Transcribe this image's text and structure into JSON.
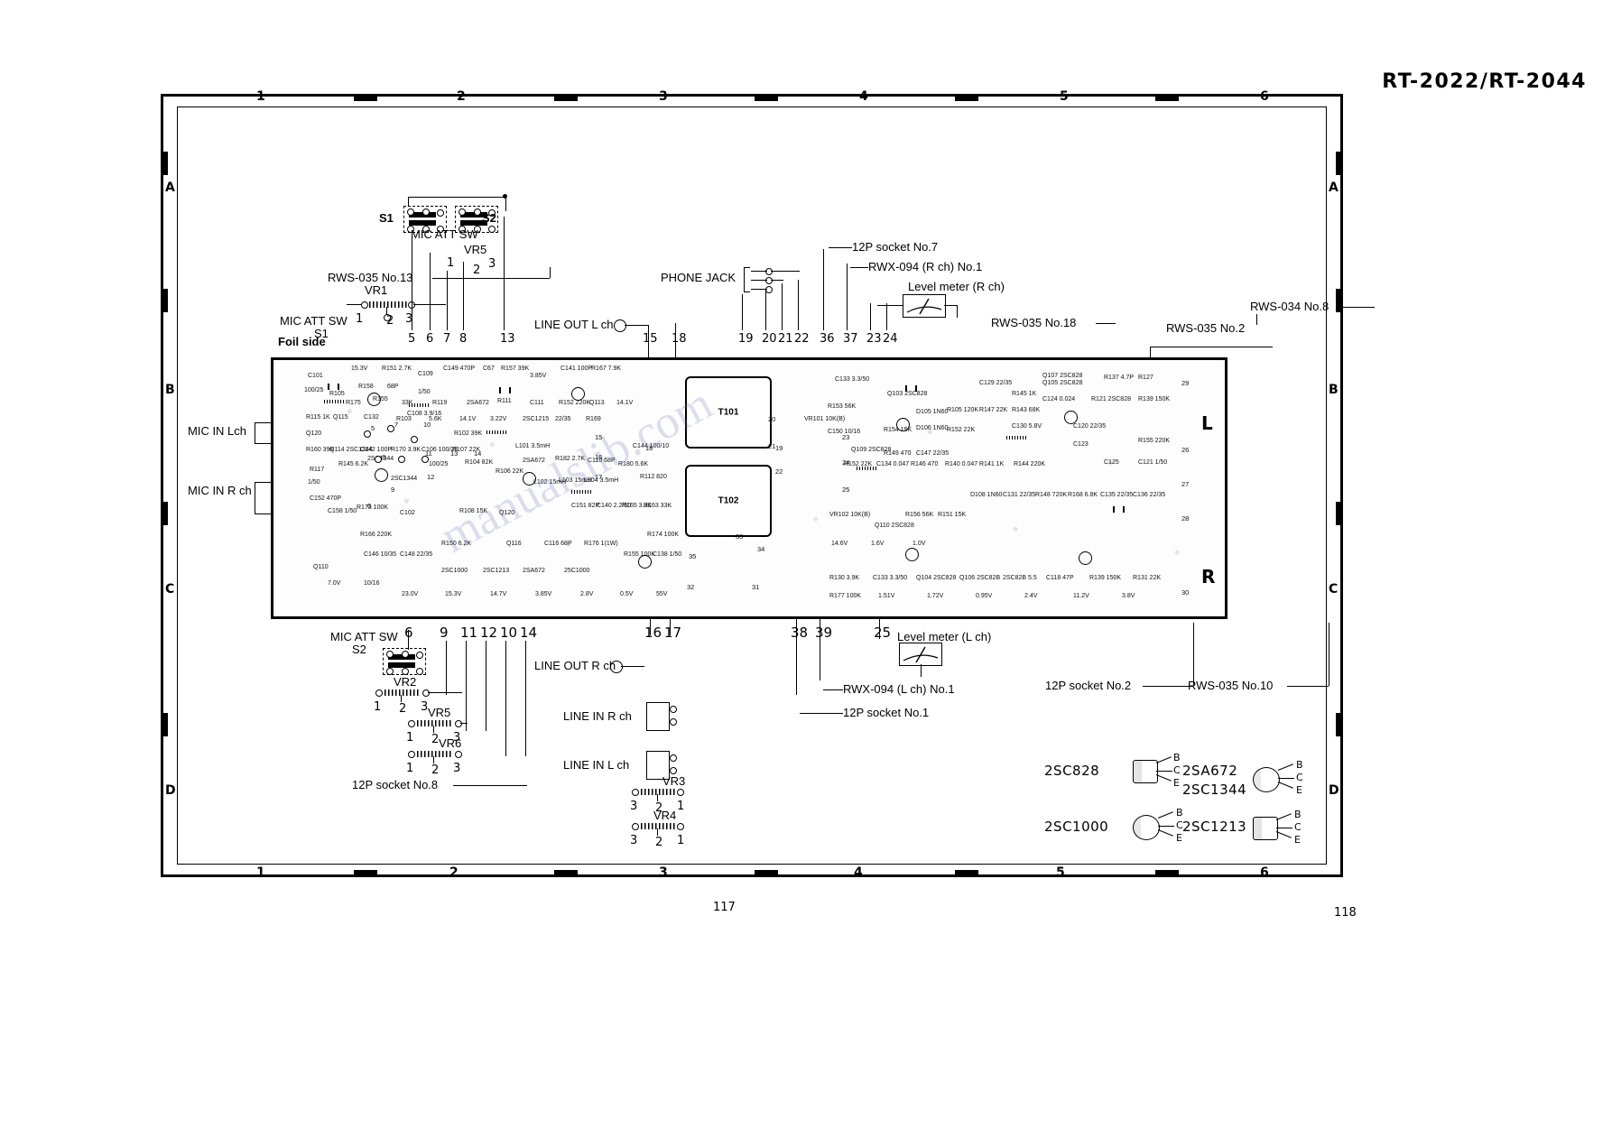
{
  "document": {
    "title": "RT-2022/RT-2044",
    "page_left": "117",
    "page_right": "118",
    "watermark": "manualslib.com"
  },
  "frame": {
    "columns": [
      "1",
      "2",
      "3",
      "4",
      "5",
      "6"
    ],
    "rows": [
      "A",
      "B",
      "C",
      "D"
    ]
  },
  "board": {
    "channel_upper": "L",
    "channel_lower": "R",
    "transformers": [
      {
        "label": "T101"
      },
      {
        "label": "T102"
      }
    ]
  },
  "annotations": {
    "foil_side": "Foil side",
    "mic_att_sw_top": "MIC ATT SW",
    "mic_att_sw_s1": "MIC ATT SW",
    "mic_att_sw_s1_ref": "S1",
    "mic_att_sw_s2": "MIC ATT SW",
    "mic_att_sw_s2_ref": "S2",
    "s1": "S1",
    "s2": "S2",
    "vr1": "VR1",
    "vr2": "VR2",
    "vr3": "VR3",
    "vr4": "VR4",
    "vr5": "VR5",
    "vr5b": "VR5",
    "vr6": "VR6",
    "rws_035_no13": "RWS-035 No.13",
    "rws_035_no18": "RWS-035 No.18",
    "rws_035_no2": "RWS-035 No.2",
    "rws_035_no10": "RWS-035 No.10",
    "rws_034_no8": "RWS-034 No.8",
    "socket_12p_no7": "12P socket No.7",
    "socket_12p_no1": "12P socket No.1",
    "socket_12p_no2": "12P socket No.2",
    "socket_12p_no8": "12P socket No.8",
    "rwx_094_r": "RWX-094 (R ch) No.1",
    "rwx_094_l": "RWX-094 (L ch) No.1",
    "phone_jack": "PHONE JACK",
    "line_out_l": "LINE OUT L ch",
    "line_out_r": "LINE OUT R ch",
    "line_in_l": "LINE IN L ch",
    "line_in_r": "LINE IN R ch",
    "mic_in_l": "MIC IN Lch",
    "mic_in_r": "MIC IN R ch",
    "level_meter_r": "Level meter (R ch)",
    "level_meter_l": "Level meter (L ch)"
  },
  "pin_numbers": {
    "vr1_terminals": [
      "1",
      "2",
      "3"
    ],
    "vr2_terminals": [
      "1",
      "2",
      "3"
    ],
    "vr3_terminals": [
      "3",
      "2",
      "1"
    ],
    "vr4_terminals": [
      "3",
      "2",
      "1"
    ],
    "vr5_terminals": [
      "1",
      "2",
      "3"
    ],
    "vr5b_terminals": [
      "1",
      "2",
      "3"
    ],
    "vr6_terminals": [
      "1",
      "2",
      "3"
    ],
    "top_row": [
      "5",
      "6",
      "7",
      "8",
      "13",
      "15",
      "18",
      "19",
      "20",
      "21",
      "22",
      "36",
      "37",
      "23",
      "24"
    ],
    "bottom_row": [
      "6",
      "9",
      "11",
      "12",
      "10",
      "14",
      "16",
      "17",
      "38",
      "39",
      "25"
    ],
    "left_col": [
      "1",
      "2",
      "3"
    ],
    "board_left_markers": [
      "5",
      "7",
      "10",
      "8",
      "11",
      "13",
      "14",
      "12",
      "9",
      "6"
    ],
    "board_mid_markers": [
      "18",
      "15",
      "16",
      "17",
      "19",
      "20",
      "21",
      "22",
      "23",
      "24",
      "25",
      "35",
      "34",
      "33",
      "32",
      "31",
      "36",
      "37",
      "38",
      "39"
    ],
    "board_right_markers": [
      "29",
      "26",
      "27",
      "28",
      "30"
    ]
  },
  "legend": {
    "items": [
      {
        "name": "2SC828",
        "package": "can",
        "pins": [
          "B",
          "C",
          "E"
        ]
      },
      {
        "name": "2SA672",
        "package": "round",
        "pins": [
          "B",
          "C",
          "E"
        ]
      },
      {
        "name": "2SC1344",
        "package": "round",
        "pins": [
          "B",
          "C",
          "E"
        ]
      },
      {
        "name": "2SC1000",
        "package": "round",
        "pins": [
          "B",
          "C",
          "E"
        ]
      },
      {
        "name": "2SC1213",
        "package": "round",
        "pins": [
          "B",
          "C",
          "E"
        ]
      }
    ]
  },
  "components": {
    "left_block": [
      "C101",
      "100/25",
      "R105",
      "15.3V",
      "R151 2.7K",
      "C109",
      "R158",
      "68P",
      "1/50",
      "C149 470P",
      "C67",
      "R157 39K",
      "3.85V",
      "C141 100P",
      "R167 7.9K",
      "R175",
      "R155",
      "33K",
      "R119",
      "2SA672",
      "R111",
      "C111",
      "R152 220K",
      "Q113",
      "14.1V",
      "R115 1K",
      "Q115",
      "C132",
      "R103",
      "5.6K",
      "14.1V",
      "3.22V",
      "2SC1215",
      "22/35",
      "R169",
      "R117",
      "1/50",
      "R145 6.2K",
      "2SC1344",
      "2SC1344",
      "R173 100K",
      "C102",
      "100/25",
      "R104 82K",
      "R108 15K",
      "Q120",
      "2SA672",
      "R182 2.7K",
      "C110 68P",
      "R180 5.6K",
      "C152 470P",
      "C158 1/50",
      "R166 220K",
      "R160 39K",
      "Q114 2SC1344",
      "C142 100P",
      "R170 3.9K",
      "C106 100/25",
      "R107 22K",
      "C108 3.9/16",
      "R102 39K",
      "R106 22K",
      "R150 6.2K",
      "L101 3.5mH",
      "L102 15mH",
      "L103 15mH",
      "L104 3.5mH",
      "C151 82P",
      "C140 2.2/50",
      "R165 3.3K",
      "C144 100/10",
      "R112 820",
      "R163 33K",
      "R174 100K",
      "Q116",
      "C116 68P",
      "R176 1(1W)",
      "R155 100K",
      "C138 1/50",
      "C146 10/35",
      "C148 22/35",
      "2SC1000",
      "2SC1213",
      "2SA672",
      "25C1000",
      "7.0V",
      "10/16",
      "23.0V",
      "15.3V",
      "14.7V",
      "3.85V",
      "2.8V",
      "0.5V",
      "55V",
      "Q110",
      "Q120"
    ],
    "right_block": [
      "C133 3.3/50",
      "R153 56K",
      "C150 10/16",
      "VR101 10K(B)",
      "Q109 2SC828",
      "R154 15K",
      "R149 470",
      "C147 22/35",
      "D105 1N60",
      "D106 1N60",
      "R105 120K",
      "R152 22K",
      "R147 22K",
      "C129 22/35",
      "R145 1K",
      "R143 68K",
      "C130 5.8V",
      "C124 0.024",
      "Q105 2SC828",
      "Q103 2SC828",
      "Q107 2SC828",
      "R137 4.7P",
      "R127",
      "R139 150K",
      "R121 2SC828",
      "C120 22/35",
      "C123",
      "C125",
      "R144 220K",
      "R141 1K",
      "R140 0.047",
      "R146 470",
      "C134 0.047",
      "R152 22K",
      "R155 220K",
      "C121 1/50",
      "VR102 10K(B)",
      "Q110 2SC828",
      "R156 56K",
      "R151 15K",
      "D108 1N60",
      "C131 22/35",
      "R148 720K",
      "R168 6.8K",
      "C135 22/35",
      "C136 22/35",
      "R130 3.9K",
      "C133 3.3/50",
      "Q104 2SC828",
      "Q106 2SC82B",
      "2SC82B 5.5",
      "C118 47P",
      "R139 150K",
      "R131 22K",
      "R177 100K",
      "1.51V",
      "1.72V",
      "0.95V",
      "2.4V",
      "11.2V",
      "3.8V",
      "14.6V",
      "1.6V",
      "1.0V"
    ]
  }
}
